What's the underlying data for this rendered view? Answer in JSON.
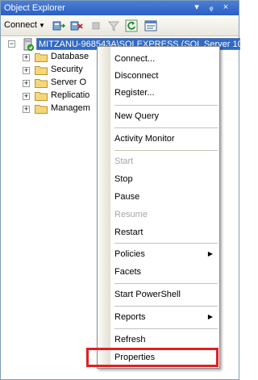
{
  "window": {
    "title": "Object Explorer",
    "controls": {
      "dropdown": "▾",
      "pin": "ᵩ",
      "close": "×"
    }
  },
  "toolbar": {
    "connect_label": "Connect",
    "connect_arrow": "▼",
    "icons": [
      "connect-object-explorer-icon",
      "disconnect-icon",
      "stop-icon",
      "filter-icon",
      "refresh-icon",
      "summary-icon"
    ]
  },
  "tree": {
    "server": {
      "expander": "−",
      "label": "MITZANU-968543A\\SQLEXPRESS (SQL Server 10."
    },
    "children": [
      {
        "expander": "+",
        "label": "Database"
      },
      {
        "expander": "+",
        "label": "Security"
      },
      {
        "expander": "+",
        "label": "Server O"
      },
      {
        "expander": "+",
        "label": "Replicatio"
      },
      {
        "expander": "+",
        "label": "Managem"
      }
    ]
  },
  "context_menu": {
    "items": [
      {
        "label": "Connect...",
        "disabled": false
      },
      {
        "label": "Disconnect",
        "disabled": false
      },
      {
        "label": "Register...",
        "disabled": false
      },
      {
        "label": "New Query",
        "disabled": false
      },
      {
        "label": "Activity Monitor",
        "disabled": false
      },
      {
        "label": "Start",
        "disabled": true
      },
      {
        "label": "Stop",
        "disabled": false
      },
      {
        "label": "Pause",
        "disabled": false
      },
      {
        "label": "Resume",
        "disabled": true
      },
      {
        "label": "Restart",
        "disabled": false
      },
      {
        "label": "Policies",
        "disabled": false,
        "submenu": true
      },
      {
        "label": "Facets",
        "disabled": false
      },
      {
        "label": "Start PowerShell",
        "disabled": false
      },
      {
        "label": "Reports",
        "disabled": false,
        "submenu": true
      },
      {
        "label": "Refresh",
        "disabled": false
      },
      {
        "label": "Properties",
        "disabled": false
      }
    ],
    "submenu_arrow": "▶"
  },
  "colors": {
    "selection": "#316ac5",
    "highlight_box": "#e02020",
    "disabled_text": "#a7a6aa"
  }
}
